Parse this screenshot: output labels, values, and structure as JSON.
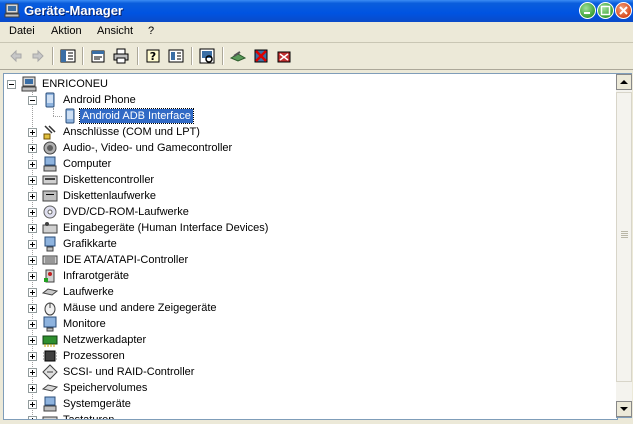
{
  "window": {
    "title": "Geräte-Manager",
    "icon": "device-manager-icon",
    "controls": [
      "minimize-icon",
      "maximize-icon",
      "close-icon"
    ]
  },
  "menu": [
    {
      "label": "Datei"
    },
    {
      "label": "Aktion"
    },
    {
      "label": "Ansicht"
    },
    {
      "label": "?"
    }
  ],
  "toolbar": [
    "back-arrow-icon",
    "forward-arrow-icon",
    "console-tree-icon",
    "properties-icon",
    "print-icon",
    "help-icon",
    "view-icon",
    "scan-hardware-icon",
    "update-driver-icon",
    "disable-device-icon",
    "uninstall-device-icon"
  ],
  "tree": {
    "root": "ENRICONEU",
    "expanded_group": "Android Phone",
    "selected_child": "Android ADB Interface",
    "categories": [
      {
        "label": "Anschlüsse (COM und LPT)",
        "icon": "port-icon"
      },
      {
        "label": "Audio-, Video- und Gamecontroller",
        "icon": "speaker-icon"
      },
      {
        "label": "Computer",
        "icon": "computer-icon"
      },
      {
        "label": "Diskettencontroller",
        "icon": "floppy-controller-icon"
      },
      {
        "label": "Diskettenlaufwerke",
        "icon": "floppy-drive-icon"
      },
      {
        "label": "DVD/CD-ROM-Laufwerke",
        "icon": "cdrom-icon"
      },
      {
        "label": "Eingabegeräte (Human Interface Devices)",
        "icon": "hid-icon"
      },
      {
        "label": "Grafikkarte",
        "icon": "display-adapter-icon"
      },
      {
        "label": "IDE ATA/ATAPI-Controller",
        "icon": "ide-controller-icon"
      },
      {
        "label": "Infrarotgeräte",
        "icon": "infrared-icon"
      },
      {
        "label": "Laufwerke",
        "icon": "disk-drive-icon"
      },
      {
        "label": "Mäuse und andere Zeigegeräte",
        "icon": "mouse-icon"
      },
      {
        "label": "Monitore",
        "icon": "monitor-icon"
      },
      {
        "label": "Netzwerkadapter",
        "icon": "network-adapter-icon"
      },
      {
        "label": "Prozessoren",
        "icon": "processor-icon"
      },
      {
        "label": "SCSI- und RAID-Controller",
        "icon": "scsi-controller-icon"
      },
      {
        "label": "Speichervolumes",
        "icon": "storage-volume-icon"
      },
      {
        "label": "Systemgeräte",
        "icon": "system-device-icon"
      },
      {
        "label": "Tastaturen",
        "icon": "keyboard-icon"
      }
    ]
  },
  "colors": {
    "titlebar": "#0053e1",
    "selection": "#316ac5",
    "window_bg": "#ece9d8"
  }
}
